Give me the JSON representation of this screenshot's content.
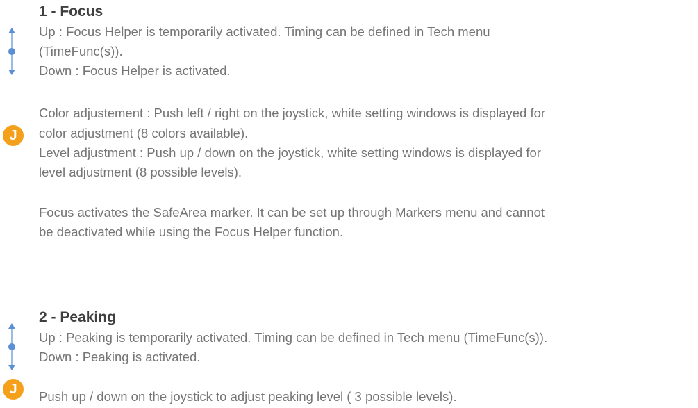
{
  "sections": [
    {
      "title": "1 - Focus",
      "updown_icon": "up-down-arrow-icon",
      "up_line1": "Up : Focus Helper is temporarily activated. Timing can be defined in Tech menu",
      "up_line2": "(TimeFunc(s)).",
      "down": "Down : Focus Helper is activated.",
      "joystick_icon": {
        "name": "joystick-icon",
        "letter": "J",
        "color": "#f5a01a"
      },
      "color_adj_line1": "Color adjustement : Push left / right on the joystick, white setting windows is displayed for",
      "color_adj_line2": "color adjustment (8 colors available).",
      "level_adj_line1": "Level adjustment : Push up / down on the joystick, white setting windows is displayed for",
      "level_adj_line2": "level adjustment (8 possible levels).",
      "note_line1": "Focus activates the SafeArea marker. It can be set up through Markers menu and cannot",
      "note_line2": "be deactivated while using the Focus Helper function."
    },
    {
      "title": "2 - Peaking",
      "updown_icon": "up-down-arrow-icon",
      "up": "Up : Peaking is temporarily activated. Timing can be defined in Tech menu (TimeFunc(s)).",
      "down": "Down : Peaking is activated.",
      "joystick_icon": {
        "name": "joystick-icon",
        "letter": "J",
        "color": "#f5a01a"
      },
      "joystick_text": "Push up / down on the joystick to adjust peaking level ( 3 possible levels)."
    }
  ],
  "colors": {
    "heading": "#3f3f3f",
    "body_text": "#757575",
    "arrow_blue": "#5b8fd6",
    "joystick_orange": "#f5a01a"
  }
}
